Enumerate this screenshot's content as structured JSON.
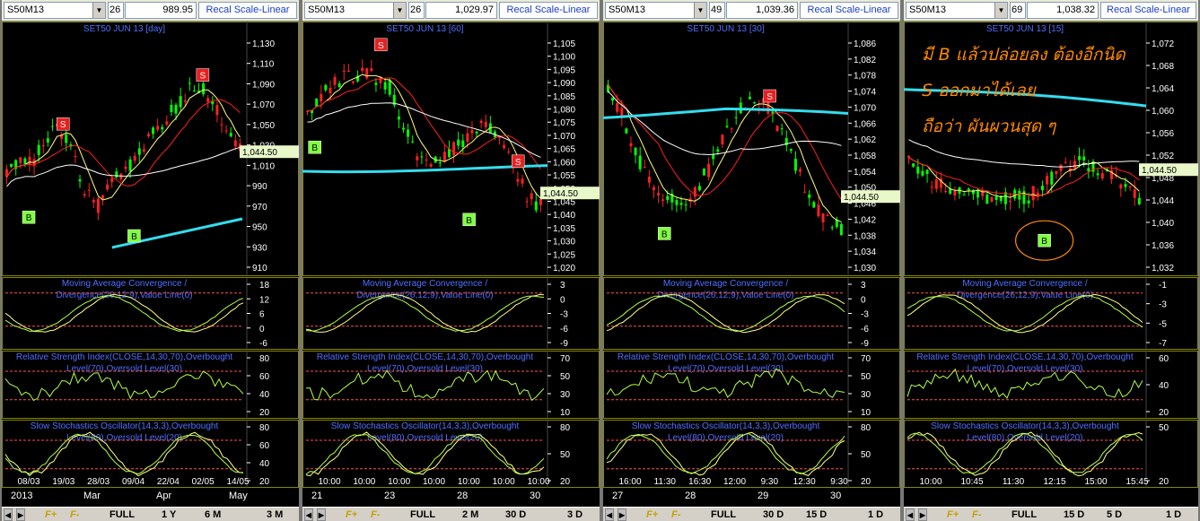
{
  "colors": {
    "up": "#00ff00",
    "down": "#ff2020",
    "bg": "#000000",
    "ma_red": "#ff2020",
    "ma_yellow": "#ffff80",
    "ma_white": "#ffffff",
    "ma_cyan": "#33ddee",
    "label": "#4f6fff",
    "axis": "#ffffff",
    "level": "#ff5050",
    "panel_border": "#888800",
    "last_price_bg": "#e8f8c8"
  },
  "panels": [
    {
      "symbol": "S50M13",
      "field_num": "26",
      "price": "989.95",
      "scale_label": "Recal Scale-Linear",
      "main_title": "SET50 JUN 13   [day]",
      "last_price": "1,044.50",
      "y_ticks": [
        "1,130",
        "1,110",
        "1,090",
        "1,070",
        "1,050",
        "1,030",
        "1,010",
        "990",
        "970",
        "950",
        "930",
        "910"
      ],
      "macd_title": "Moving Average Convergence /\nDivergence(26,12,9),Value Line(0)",
      "macd_ticks": [
        "18",
        "12",
        "6",
        "0",
        "-6"
      ],
      "rsi_title": "Relative Strength Index(CLOSE,14,30,70),Overbought\nLevel(70),Oversold Level(30)",
      "rsi_ticks": [
        "80",
        "60",
        "40",
        "20"
      ],
      "stoch_title": "Slow Stochastics Oscillator(14,3,3),Overbought\nLevel(80),Oversold Level(20)",
      "stoch_ticks": [
        "80",
        "60",
        "40",
        "20"
      ],
      "date_labels_top": [
        "08/03",
        "19/03",
        "28/03",
        "09/04",
        "22/04",
        "02/05",
        "14/05"
      ],
      "date_labels_bottom": [
        "2013",
        "Mar",
        "Apr",
        "May"
      ],
      "signals": [
        {
          "type": "S"
        },
        {
          "type": "S"
        },
        {
          "type": "B"
        },
        {
          "type": "B"
        }
      ],
      "toolbar": {
        "f_plus": "F+",
        "f_minus": "F-",
        "full": "FULL",
        "b1": "1 Y",
        "b2": "6 M",
        "b3": "3 M"
      }
    },
    {
      "symbol": "S50M13",
      "field_num": "26",
      "price": "1,029.97",
      "scale_label": "Recal Scale-Linear",
      "main_title": "SET50 JUN 13   [60]",
      "last_price": "1,044.50",
      "y_ticks": [
        "1,105",
        "1,100",
        "1,095",
        "1,090",
        "1,085",
        "1,080",
        "1,075",
        "1,070",
        "1,065",
        "1,060",
        "1,055",
        "1,050",
        "1,045",
        "1,040",
        "1,035",
        "1,030",
        "1,025",
        "1,020"
      ],
      "macd_title": "Moving Average Convergence /\nDivergence(26,12,9),Value Line(0)",
      "macd_ticks": [
        "3",
        "0",
        "-3",
        "-6",
        "-9"
      ],
      "rsi_title": "Relative Strength Index(CLOSE,14,30,70),Overbought\nLevel(70),Oversold Level(30)",
      "rsi_ticks": [
        "70",
        "50",
        "30",
        "10"
      ],
      "stoch_title": "Slow Stochastics Oscillator(14,3,3),Overbought\nLevel(80),Oversold Level(20)",
      "stoch_ticks": [
        "80",
        "50",
        "20"
      ],
      "date_labels_top": [
        "10:00",
        "10:00",
        "10:00",
        "10:00",
        "10:00",
        "10:00",
        "10:00"
      ],
      "date_labels_bottom": [
        "21",
        "23",
        "28",
        "30"
      ],
      "signals": [
        {
          "type": "S"
        },
        {
          "type": "S"
        },
        {
          "type": "B"
        },
        {
          "type": "B"
        }
      ],
      "toolbar": {
        "f_plus": "F+",
        "f_minus": "F-",
        "full": "FULL",
        "b1": "2 M",
        "b2": "30 D",
        "b3": "3 D"
      }
    },
    {
      "symbol": "S50M13",
      "field_num": "49",
      "price": "1,039.36",
      "scale_label": "Recal Scale-Linear",
      "main_title": "SET50 JUN 13   [30]",
      "last_price": "1,044.50",
      "y_ticks": [
        "1,086",
        "1,082",
        "1,078",
        "1,074",
        "1,070",
        "1,066",
        "1,062",
        "1,058",
        "1,054",
        "1,050",
        "1,046",
        "1,042",
        "1,038",
        "1,034",
        "1,030"
      ],
      "macd_title": "Moving Average Convergence /\nDivergence(26,12,9),Value Line(0)",
      "macd_ticks": [
        "3",
        "0",
        "-3",
        "-6",
        "-9"
      ],
      "rsi_title": "Relative Strength Index(CLOSE,14,30,70),Overbought\nLevel(70),Oversold Level(30)",
      "rsi_ticks": [
        "70",
        "50",
        "30",
        "10"
      ],
      "stoch_title": "Slow Stochastics Oscillator(14,3,3),Overbought\nLevel(80),Oversold Level(20)",
      "stoch_ticks": [
        "80",
        "50",
        "20"
      ],
      "date_labels_top": [
        "16:00",
        "11:30",
        "16:30",
        "12:00",
        "9:30",
        "12:30",
        "9:30"
      ],
      "date_labels_bottom": [
        "27",
        "28",
        "29",
        "30"
      ],
      "signals": [
        {
          "type": "S"
        },
        {
          "type": "B"
        }
      ],
      "toolbar": {
        "f_plus": "F+",
        "f_minus": "F-",
        "full": "FULL",
        "b1": "30 D",
        "b2": "15 D",
        "b3": "1 D"
      }
    },
    {
      "symbol": "S50M13",
      "field_num": "69",
      "price": "1,038.32",
      "scale_label": "Recal Scale-Linear",
      "main_title": "SET50 JUN 13   [15]",
      "last_price": "1,044.50",
      "y_ticks": [
        "1,072",
        "1,068",
        "1,064",
        "1,060",
        "1,056",
        "1,052",
        "1,048",
        "1,044",
        "1,040",
        "1,036",
        "1,032"
      ],
      "macd_title": "Moving Average Convergence /\nDivergence(26,12,9),Value Line(0)",
      "macd_ticks": [
        "-1",
        "-3",
        "-5",
        "-7"
      ],
      "rsi_title": "Relative Strength Index(CLOSE,14,30,70),Overbought\nLevel(70),Oversold Level(30)",
      "rsi_ticks": [
        "60",
        "40",
        "20"
      ],
      "stoch_title": "Slow Stochastics Oscillator(14,3,3),Overbought\nLevel(80),Oversold Level(20)",
      "stoch_ticks": [
        "50",
        "20"
      ],
      "date_labels_top": [
        "10:00",
        "10:45",
        "11:30",
        "12:15",
        "15:00",
        "15:45"
      ],
      "date_labels_bottom": [],
      "signals": [
        {
          "type": "B"
        }
      ],
      "annotation": [
        "มี B แล้วปล่อยลง ต้องอีกนิด",
        "S ออกมาได้เลย",
        "ถือว่า ผันผวนสุด ๆ"
      ],
      "toolbar": {
        "f_plus": "F+",
        "f_minus": "F-",
        "full": "FULL",
        "b1": "15 D",
        "b2": "5 D",
        "b3": "1 D"
      }
    }
  ]
}
